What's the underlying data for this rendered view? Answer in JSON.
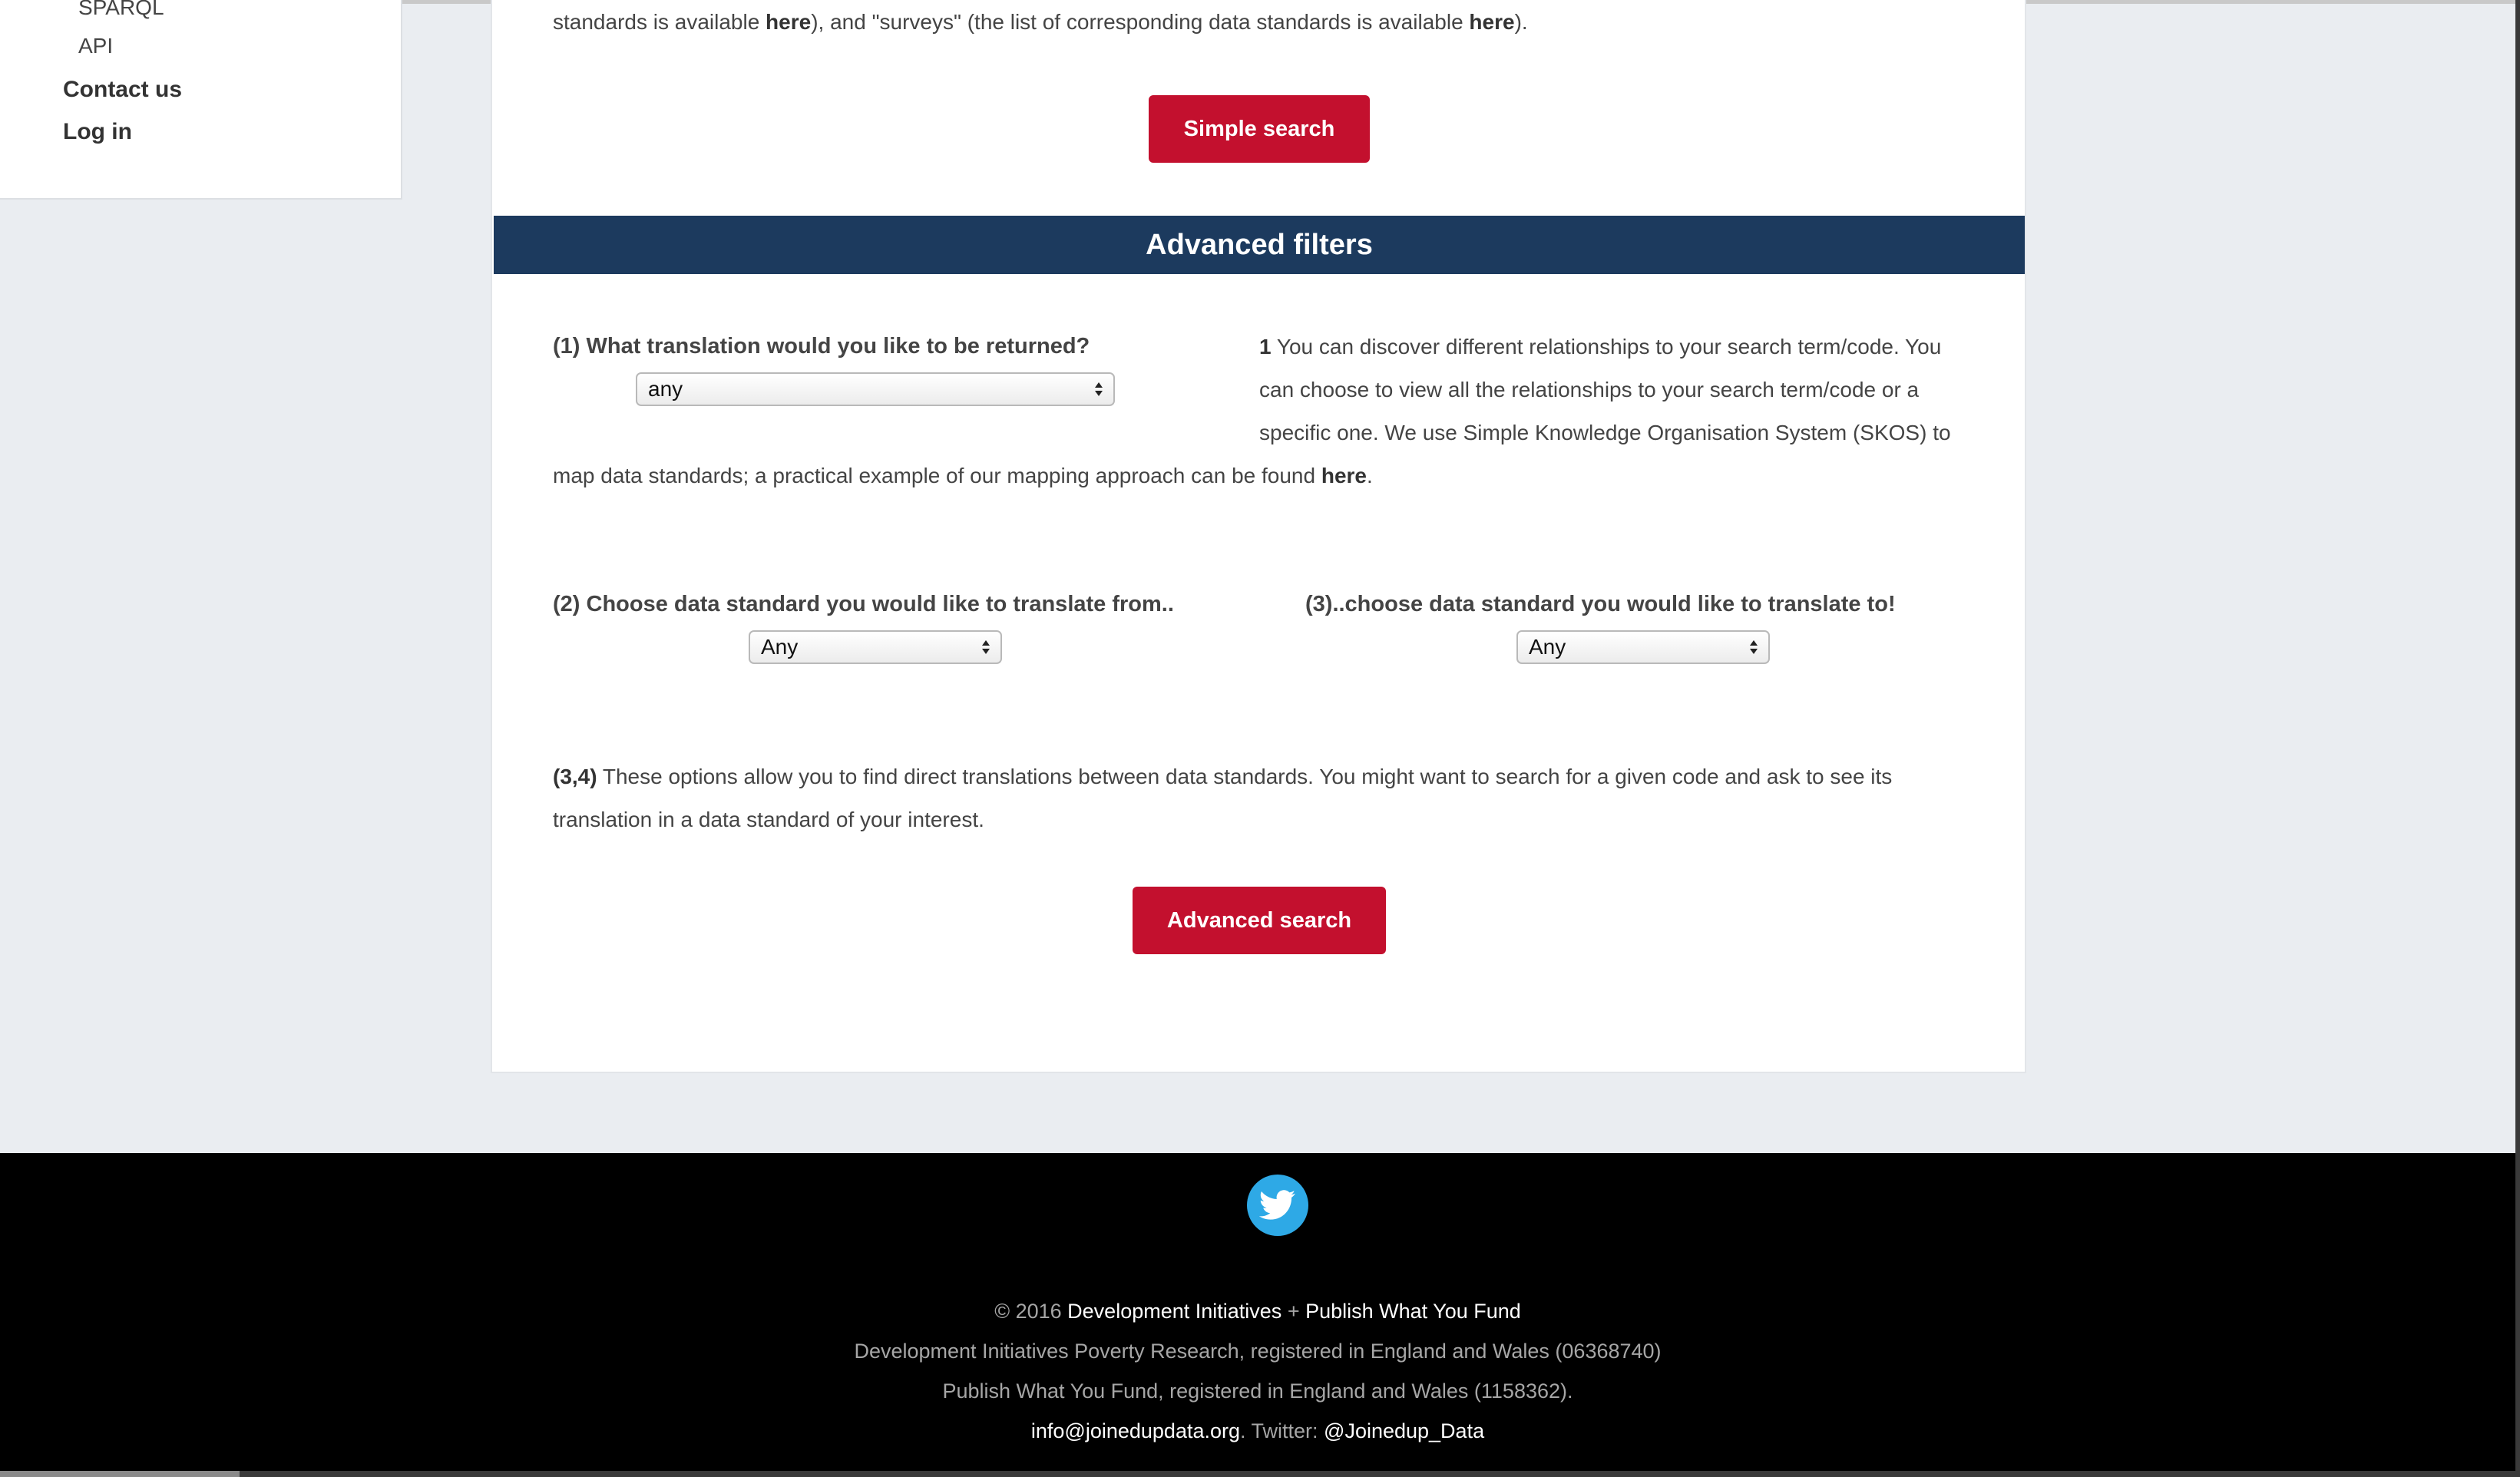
{
  "sidebar": {
    "items": [
      {
        "label": "SPARQL"
      },
      {
        "label": "API"
      },
      {
        "label": "Contact us"
      },
      {
        "label": "Log in"
      }
    ]
  },
  "intro": {
    "line_pre": "standards is available ",
    "here1": "here",
    "line_mid": "), and \"surveys\" (the list of corresponding data standards is available ",
    "here2": "here",
    "line_end": ")."
  },
  "simple_search_label": "Simple search",
  "advanced": {
    "title": "Advanced filters",
    "q1_label": "(1) What translation would you like to be returned?",
    "q1_value": "any",
    "note1_num": "1",
    "note1_line1": " You can discover different relationships to your search term/code. You",
    "note1_line2": "can choose to view all the relationships to your search term/code or a",
    "note1_line3": "specific one. We use Simple Knowledge Organisation System (SKOS) to",
    "note1_line4": "map data standards; a practical example of our mapping approach can be found ",
    "note1_here": "here",
    "note1_end": ".",
    "q2_label": "(2) Choose data standard you would like to translate from..",
    "q2_value": "Any",
    "q3_label": "(3)..choose data standard you would like to translate to!",
    "q3_value": "Any",
    "note34_num": "(3,4)",
    "note34_line1": " These options allow you to find direct translations between data standards. You might want to search for a given code and ask to see its",
    "note34_line2": "translation in a data standard of your interest.",
    "button_label": "Advanced search"
  },
  "footer": {
    "twitter_icon": "twitter-bird-icon",
    "copyright_prefix": "© 2016 ",
    "org1": "Development Initiatives",
    "plus": " + ",
    "org2": "Publish What You Fund",
    "reg1": "Development Initiatives Poverty Research, registered in England and Wales (06368740)",
    "reg2": "Publish What You Fund, registered in England and Wales (1158362).",
    "email": "info@joinedupdata.org",
    "email_sep": ". Twitter: ",
    "twitter_handle": "@Joinedup_Data"
  },
  "colors": {
    "accent_red": "#c3102e",
    "header_navy": "#1c3a5e",
    "twitter_blue": "#2ea9e6",
    "page_bg": "#eaedf1"
  }
}
